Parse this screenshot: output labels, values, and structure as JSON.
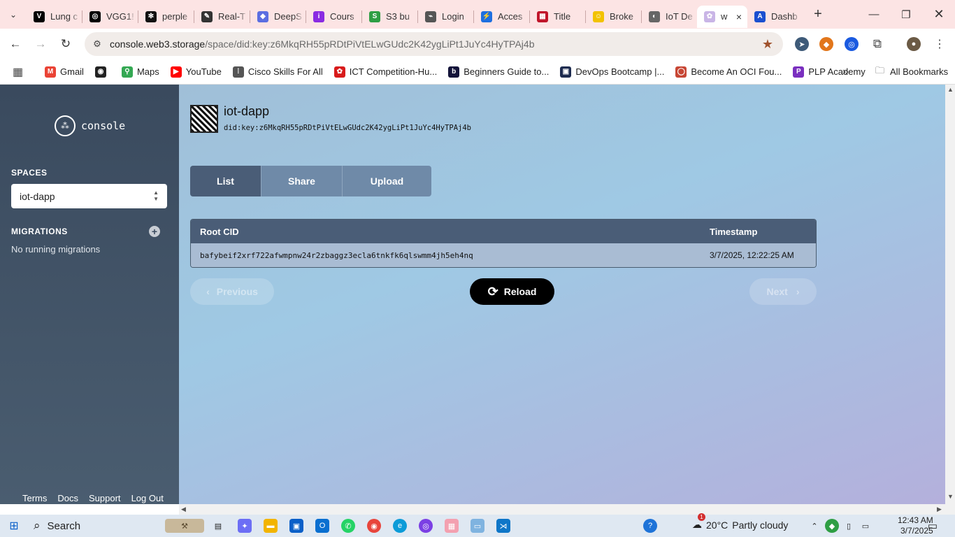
{
  "browser": {
    "tabs": [
      {
        "label": "Lung c",
        "color": "#000000",
        "glyph": "V"
      },
      {
        "label": "VGG1!",
        "color": "#000000",
        "glyph": "◎"
      },
      {
        "label": "perple",
        "color": "#111111",
        "glyph": "✻"
      },
      {
        "label": "Real-T",
        "color": "#333333",
        "glyph": "✎"
      },
      {
        "label": "DeepS",
        "color": "#5b6ee1",
        "glyph": "◆"
      },
      {
        "label": "Cours",
        "color": "#8a2be2",
        "glyph": "i"
      },
      {
        "label": "S3 bu",
        "color": "#2e9e44",
        "glyph": "S"
      },
      {
        "label": "Login",
        "color": "#555555",
        "glyph": "⌁"
      },
      {
        "label": "Acces",
        "color": "#1e6fe0",
        "glyph": "⚡"
      },
      {
        "label": "Title",
        "color": "#c0152a",
        "glyph": "▦"
      },
      {
        "label": "Broke",
        "color": "#f2c200",
        "glyph": "☺"
      },
      {
        "label": "IoT De",
        "color": "#666666",
        "glyph": "◐"
      }
    ],
    "active_tab": {
      "label": "w",
      "close": "×"
    },
    "last_tab": {
      "label": "Dashb",
      "color": "#1a4fd0",
      "glyph": "A"
    },
    "new_tab": "+",
    "url_host": "console.web3.storage",
    "url_path": "/space/did:key:z6MkqRH55pRDtPiVtELwGUdc2K42ygLiPt1JuYc4HyTPAj4b",
    "bookmarks": [
      {
        "label": "Gmail",
        "color": "#ea4335",
        "glyph": "M"
      },
      {
        "label": "",
        "color": "#222222",
        "glyph": "◉"
      },
      {
        "label": "Maps",
        "color": "#34a853",
        "glyph": "⚲"
      },
      {
        "label": "YouTube",
        "color": "#ff0000",
        "glyph": "▶"
      },
      {
        "label": "Cisco Skills For All",
        "color": "#555555",
        "glyph": "⁞"
      },
      {
        "label": "ICT Competition-Hu...",
        "color": "#d81b1b",
        "glyph": "✿"
      },
      {
        "label": "Beginners Guide to...",
        "color": "#14143a",
        "glyph": "b"
      },
      {
        "label": "DevOps Bootcamp |...",
        "color": "#1d2b4f",
        "glyph": "▣"
      },
      {
        "label": "Become An OCI Fou...",
        "color": "#c74634",
        "glyph": "◯"
      },
      {
        "label": "PLP Academy",
        "color": "#7a2fbf",
        "glyph": "P"
      }
    ],
    "bookmarks_overflow": "»",
    "all_bookmarks": "All Bookmarks"
  },
  "sidebar": {
    "logo_text": "console",
    "spaces_title": "SPACES",
    "selected_space": "iot-dapp",
    "migrations_title": "MIGRATIONS",
    "migrations_status": "No running migrations",
    "footer": [
      "Terms",
      "Docs",
      "Support",
      "Log Out"
    ]
  },
  "space": {
    "name": "iot-dapp",
    "did": "did:key:z6MkqRH55pRDtPiVtELwGUdc2K42ygLiPt1JuYc4HyTPAj4b",
    "tabs": [
      "List",
      "Share",
      "Upload"
    ],
    "active_tab": "List"
  },
  "uploads_table": {
    "headers": [
      "Root CID",
      "Timestamp"
    ],
    "rows": [
      {
        "cid": "bafybeif2xrf722afwmpnw24r2zbaggz3ecla6tnkfk6qlswmm4jh5eh4nq",
        "timestamp": "3/7/2025, 12:22:25 AM"
      }
    ]
  },
  "pager": {
    "previous": "Previous",
    "reload": "Reload",
    "next": "Next"
  },
  "taskbar": {
    "search": "Search",
    "temperature": "20°C",
    "weather": "Partly cloudy",
    "weather_badge": "1",
    "time": "12:43 AM",
    "date": "3/7/2025"
  }
}
